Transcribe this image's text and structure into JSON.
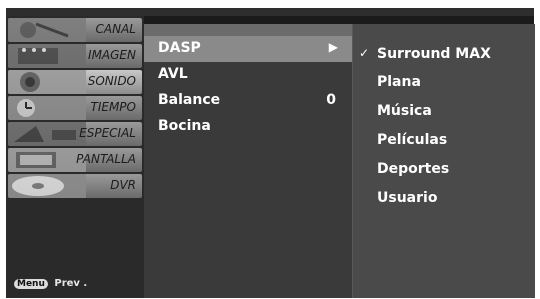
{
  "categories": [
    {
      "label": "CANAL"
    },
    {
      "label": "IMAGEN"
    },
    {
      "label": "SONIDO"
    },
    {
      "label": "TIEMPO"
    },
    {
      "label": "ESPECIAL"
    },
    {
      "label": "PANTALLA"
    },
    {
      "label": "DVR"
    }
  ],
  "footer": {
    "menu_key": "Menu",
    "prev_label": "Prev ."
  },
  "submenu": {
    "items": [
      {
        "label": "DASP",
        "value": "",
        "arrow": "▶"
      },
      {
        "label": "AVL",
        "value": ""
      },
      {
        "label": "Balance",
        "value": "0"
      },
      {
        "label": "Bocina",
        "value": ""
      }
    ]
  },
  "options": {
    "checkmark": "✓",
    "items": [
      {
        "label": "Surround MAX"
      },
      {
        "label": "Plana"
      },
      {
        "label": "Música"
      },
      {
        "label": "Películas"
      },
      {
        "label": "Deportes"
      },
      {
        "label": "Usuario"
      }
    ]
  }
}
